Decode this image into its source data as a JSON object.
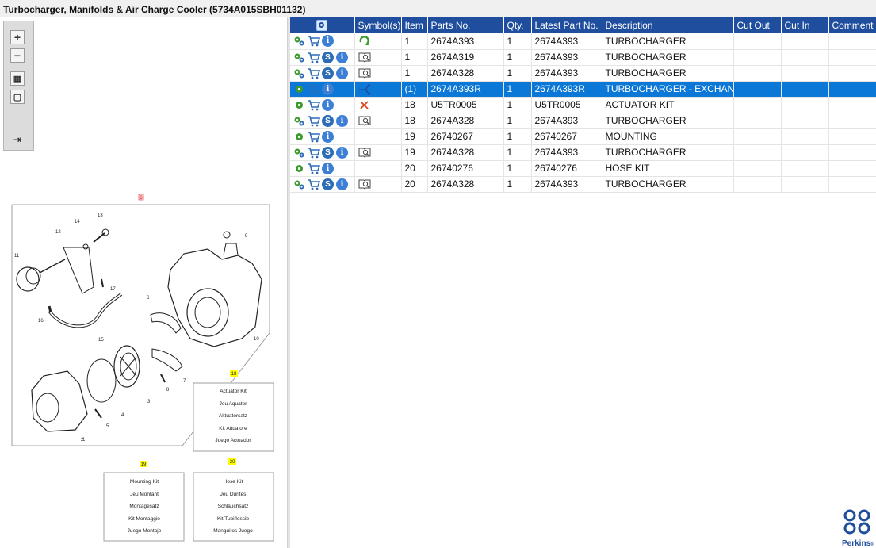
{
  "title": "Turbocharger, Manifolds & Air Charge Cooler (5734A015SBH01132)",
  "toolbox": {
    "buttons": [
      {
        "name": "zoom-in-icon",
        "glyph": "+"
      },
      {
        "name": "zoom-out-icon",
        "glyph": "−"
      },
      {
        "name": "fit-icon",
        "glyph": "▦"
      },
      {
        "name": "window-icon",
        "glyph": "▢"
      },
      {
        "name": "export-icon",
        "glyph": "⇥"
      }
    ]
  },
  "drawing": {
    "ref_label": "8",
    "callouts": [
      "1",
      "2",
      "3",
      "4",
      "5",
      "6",
      "7",
      "8",
      "9",
      "10",
      "11",
      "12",
      "13",
      "14",
      "15",
      "16",
      "17"
    ],
    "kits": [
      {
        "badge": "18",
        "lines": [
          "Actuator Kit",
          "Jeu Aquator",
          "Aktuatorsatz",
          "Kit Attuatore",
          "Juego Actuador"
        ]
      },
      {
        "badge": "19",
        "lines": [
          "Mounting Kit",
          "Jeu Montant",
          "Montagesatz",
          "Kit Montaggio",
          "Juego Montaje"
        ]
      },
      {
        "badge": "20",
        "lines": [
          "Hose Kit",
          "Jeu Durites",
          "Schlauchsatz",
          "Kit Tubiflessib",
          "Manguitos Juego"
        ]
      }
    ]
  },
  "table": {
    "headers": {
      "symbols": "Symbol(s)",
      "item": "Item",
      "parts_no": "Parts No.",
      "qty": "Qty.",
      "latest": "Latest Part No.",
      "desc": "Description",
      "cut_out": "Cut Out",
      "cut_in": "Cut In",
      "comment": "Comment"
    },
    "rows": [
      {
        "icons": [
          "gears",
          "cart",
          "info"
        ],
        "symbol": "recycle",
        "item": "1",
        "parts_no": "2674A393",
        "qty": "1",
        "latest": "2674A393",
        "desc": "TURBOCHARGER",
        "selected": false
      },
      {
        "icons": [
          "gears",
          "cart",
          "s",
          "info"
        ],
        "symbol": "book",
        "item": "1",
        "parts_no": "2674A319",
        "qty": "1",
        "latest": "2674A393",
        "desc": "TURBOCHARGER",
        "selected": false
      },
      {
        "icons": [
          "gears",
          "cart",
          "s",
          "info"
        ],
        "symbol": "book",
        "item": "1",
        "parts_no": "2674A328",
        "qty": "1",
        "latest": "2674A393",
        "desc": "TURBOCHARGER",
        "selected": false
      },
      {
        "icons": [
          "gear",
          "cart",
          "info"
        ],
        "symbol": "exchange",
        "item": "(1)",
        "parts_no": "2674A393R",
        "qty": "1",
        "latest": "2674A393R",
        "desc": "TURBOCHARGER - EXCHANGE",
        "selected": true
      },
      {
        "icons": [
          "gear",
          "cart",
          "info"
        ],
        "symbol": "cross",
        "item": "18",
        "parts_no": "U5TR0005",
        "qty": "1",
        "latest": "U5TR0005",
        "desc": "ACTUATOR KIT",
        "selected": false
      },
      {
        "icons": [
          "gears",
          "cart",
          "s",
          "info"
        ],
        "symbol": "book",
        "item": "18",
        "parts_no": "2674A328",
        "qty": "1",
        "latest": "2674A393",
        "desc": "TURBOCHARGER",
        "selected": false
      },
      {
        "icons": [
          "gear",
          "cart",
          "info"
        ],
        "symbol": "",
        "item": "19",
        "parts_no": "26740267",
        "qty": "1",
        "latest": "26740267",
        "desc": "MOUNTING",
        "selected": false
      },
      {
        "icons": [
          "gears",
          "cart",
          "s",
          "info"
        ],
        "symbol": "book",
        "item": "19",
        "parts_no": "2674A328",
        "qty": "1",
        "latest": "2674A393",
        "desc": "TURBOCHARGER",
        "selected": false
      },
      {
        "icons": [
          "gear",
          "cart",
          "info"
        ],
        "symbol": "",
        "item": "20",
        "parts_no": "26740276",
        "qty": "1",
        "latest": "26740276",
        "desc": "HOSE KIT",
        "selected": false
      },
      {
        "icons": [
          "gears",
          "cart",
          "s",
          "info"
        ],
        "symbol": "book",
        "item": "20",
        "parts_no": "2674A328",
        "qty": "1",
        "latest": "2674A393",
        "desc": "TURBOCHARGER",
        "selected": false
      }
    ]
  },
  "logo": {
    "text": "Perkins",
    "mark": "®"
  },
  "colors": {
    "header_bg": "#1f4e9e",
    "selected_row": "#0b78d7",
    "accent_green": "#3a9a2a",
    "cross_red": "#e0451d"
  }
}
